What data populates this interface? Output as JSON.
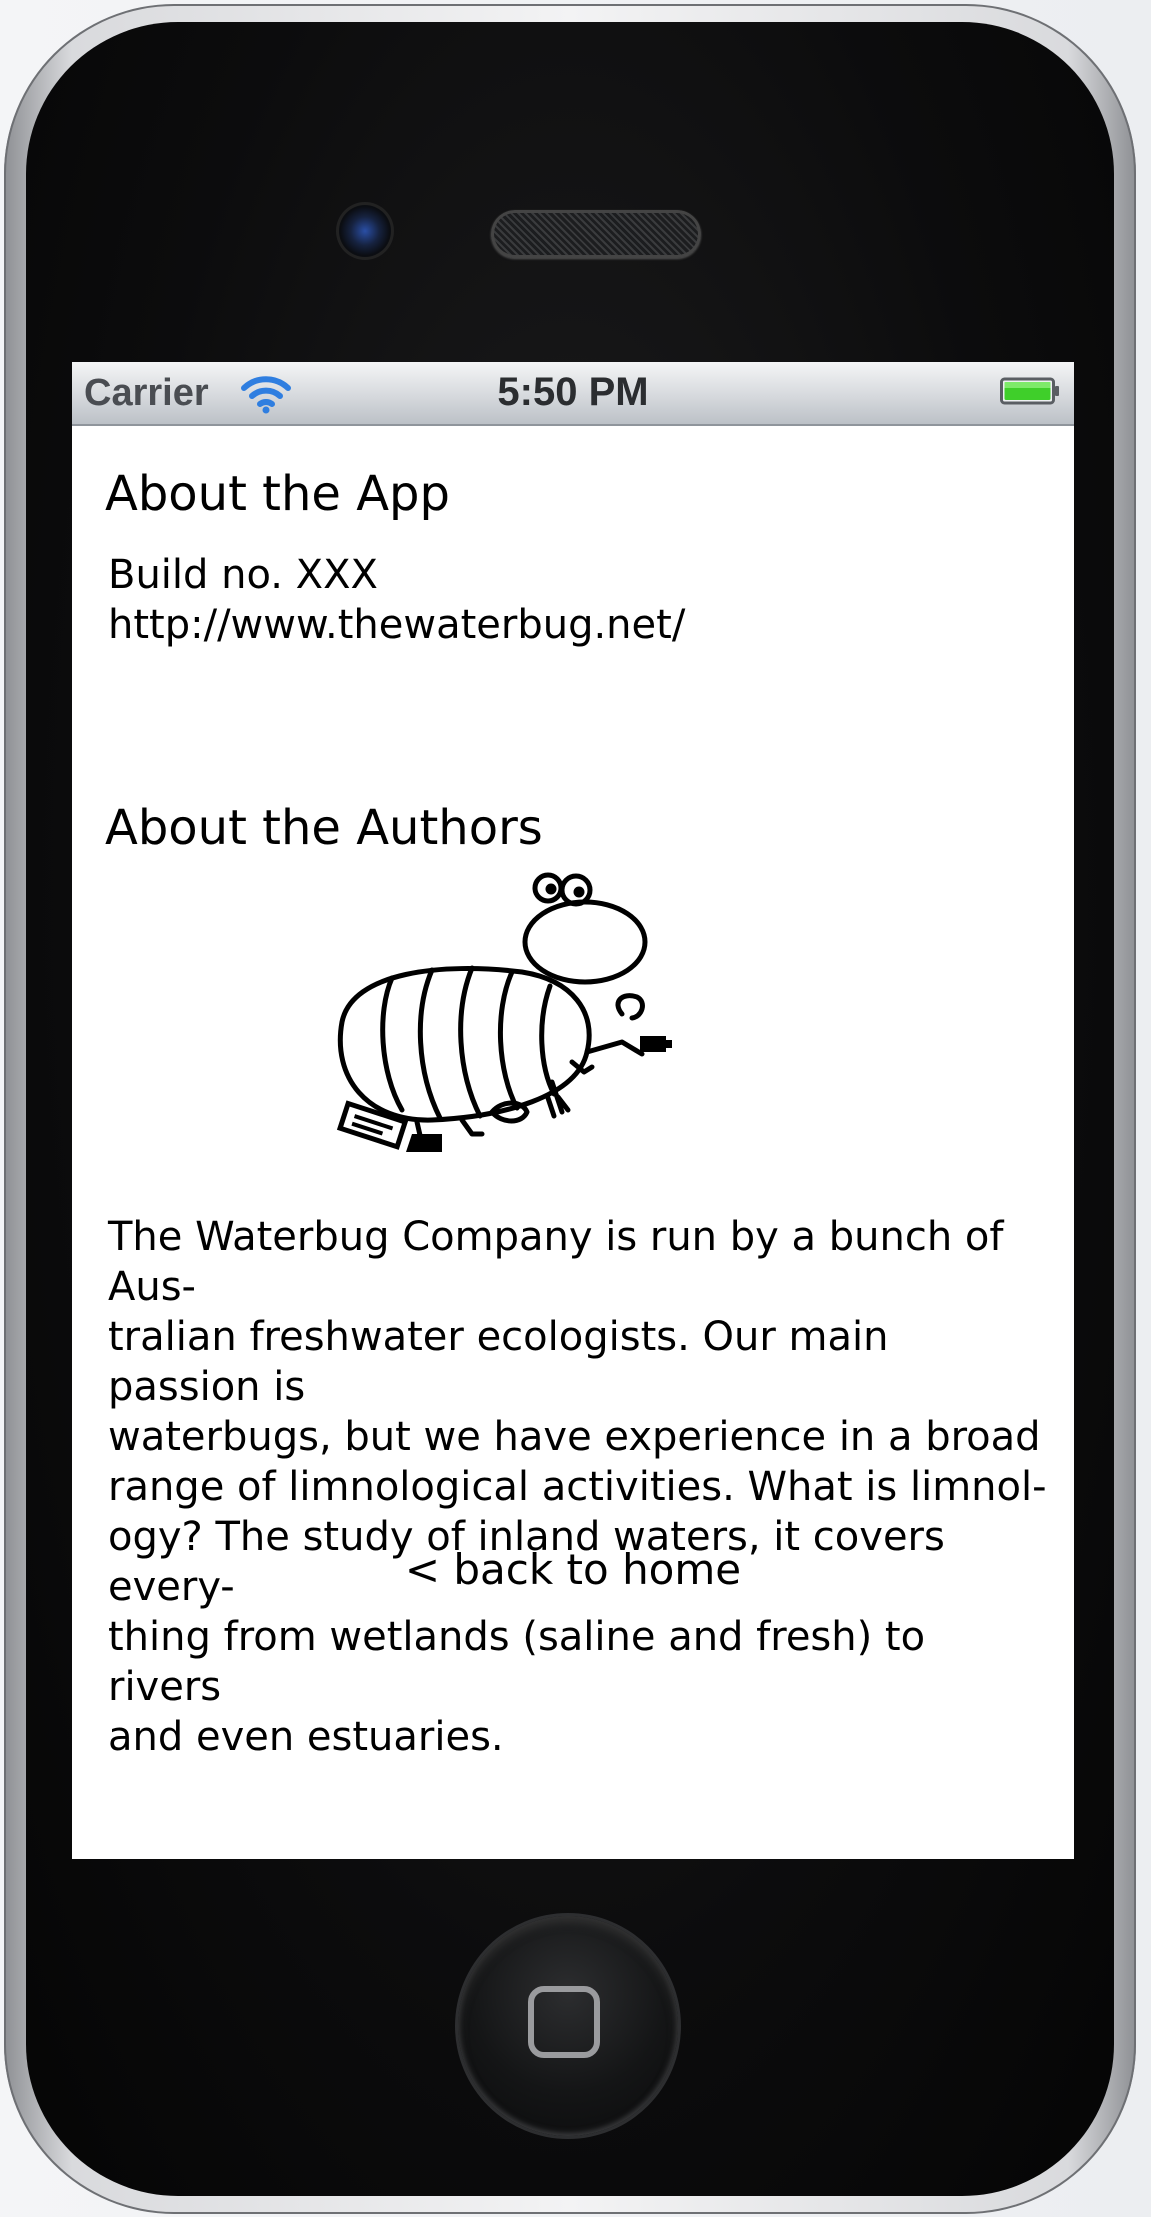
{
  "status_bar": {
    "carrier": "Carrier",
    "time": "5:50 PM",
    "wifi_icon": "wifi-icon",
    "battery_icon": "battery-icon",
    "battery_color": "#3fcf2a"
  },
  "about_app": {
    "title": "About the App",
    "build": "Build no. XXX",
    "url": "http://www.thewaterbug.net/"
  },
  "about_authors": {
    "title": "About the Authors",
    "logo_icon": "waterbug-logo",
    "body": "The Waterbug Company is run by a bunch of Aus-\ntralian freshwater ecologists. Our main passion is\nwaterbugs, but we have experience in a broad\nrange of limnological activities. What is limnol-\nogy? The study of inland waters, it covers every-\nthing from wetlands (saline and fresh) to rivers\nand even estuaries."
  },
  "navigation": {
    "back_label": "< back to home"
  },
  "device": {
    "home_button_icon": "home-button-icon"
  }
}
